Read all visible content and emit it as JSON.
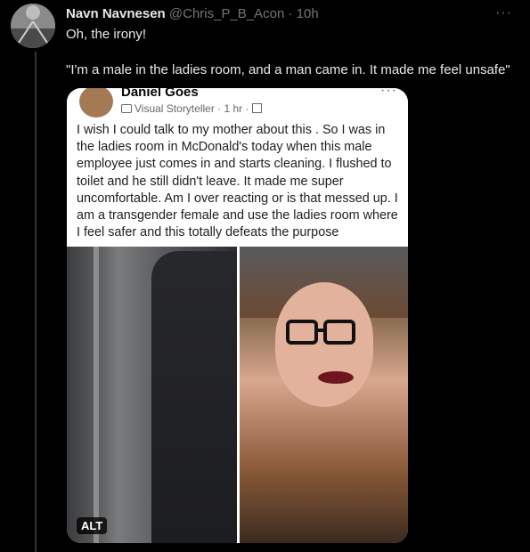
{
  "tweet": {
    "display_name": "Navn Navnesen",
    "handle": "@Chris_P_B_Acon",
    "separator": "·",
    "time": "10h",
    "more_label": "···",
    "text_line1": "Oh, the irony!",
    "text_line2": "\"I'm a male in the ladies room, and a man came in. It made me feel unsafe\""
  },
  "media": {
    "alt_badge": "ALT",
    "fb_post": {
      "author": "Daniel Goes",
      "subtitle": "Visual Storyteller · 1 hr ·",
      "more_label": "···",
      "body": "I wish I could talk to my mother about this . So I was in the ladies room in McDonald's today when this male employee just comes in and starts cleaning. I flushed to toilet and he still didn't leave. It made me super uncomfortable. Am I over reacting or is that messed up. I am a transgender female and use the ladies room where I feel safer and this totally defeats the purpose"
    }
  }
}
